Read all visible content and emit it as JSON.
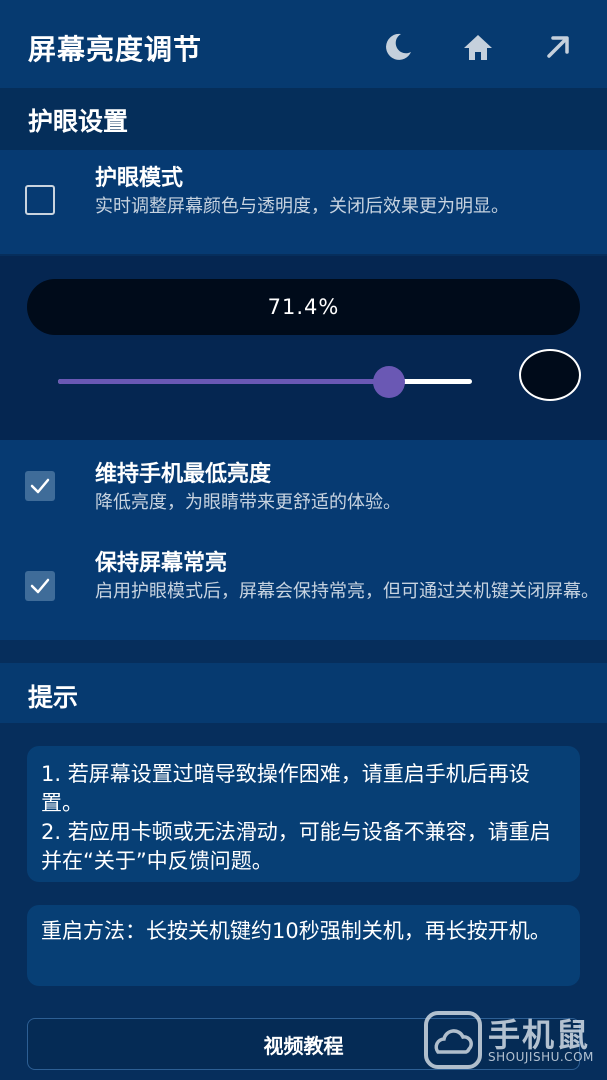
{
  "header": {
    "title": "屏幕亮度调节",
    "icons": [
      "moon-icon",
      "home-icon",
      "share-arrow-icon"
    ]
  },
  "eye_section": {
    "title": "护眼设置",
    "eye_mode": {
      "label": "护眼模式",
      "description": "实时调整屏幕颜色与透明度，关闭后效果更为明显。",
      "checked": false
    }
  },
  "slider": {
    "value_text": "71.4%",
    "position_fraction": 0.8
  },
  "options": [
    {
      "label": "维持手机最低亮度",
      "description": "降低亮度，为眼睛带来更舒适的体验。",
      "checked": true
    },
    {
      "label": "保持屏幕常亮",
      "description": "启用护眼模式后，屏幕会保持常亮，但可通过关机键关闭屏幕。",
      "checked": true
    }
  ],
  "tips_section": {
    "title": "提示",
    "tip_lines": [
      "1. 若屏幕设置过暗导致操作困难，请重启手机后再设置。",
      "2. 若应用卡顿或无法滑动，可能与设备不兼容，请重启并在“关于”中反馈问题。"
    ],
    "restart_text": "重启方法：长按关机键约10秒强制关机，再长按开机。"
  },
  "video_button": {
    "label": "视频教程"
  },
  "watermark": {
    "brand": "手机鼠",
    "domain": "SHOUJISHU.COM"
  },
  "colors": {
    "background": "#062e5c",
    "header": "#063a70",
    "accent_purple": "#6a58b4",
    "checkbox_checked": "#3f6c99"
  }
}
